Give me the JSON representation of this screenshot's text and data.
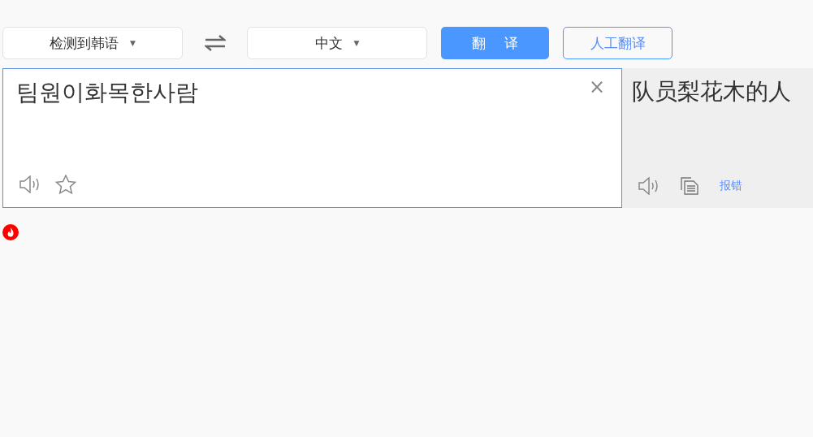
{
  "source_language": {
    "label": "检测到韩语",
    "caret": "▼"
  },
  "target_language": {
    "label": "中文",
    "caret": "▼"
  },
  "translate_button": "翻 译",
  "human_translate_button": "人工翻译",
  "input": {
    "value": "팀원이화목한사람",
    "clear": "×"
  },
  "output": {
    "text": "队员梨花木的人",
    "report_link": "报错"
  }
}
